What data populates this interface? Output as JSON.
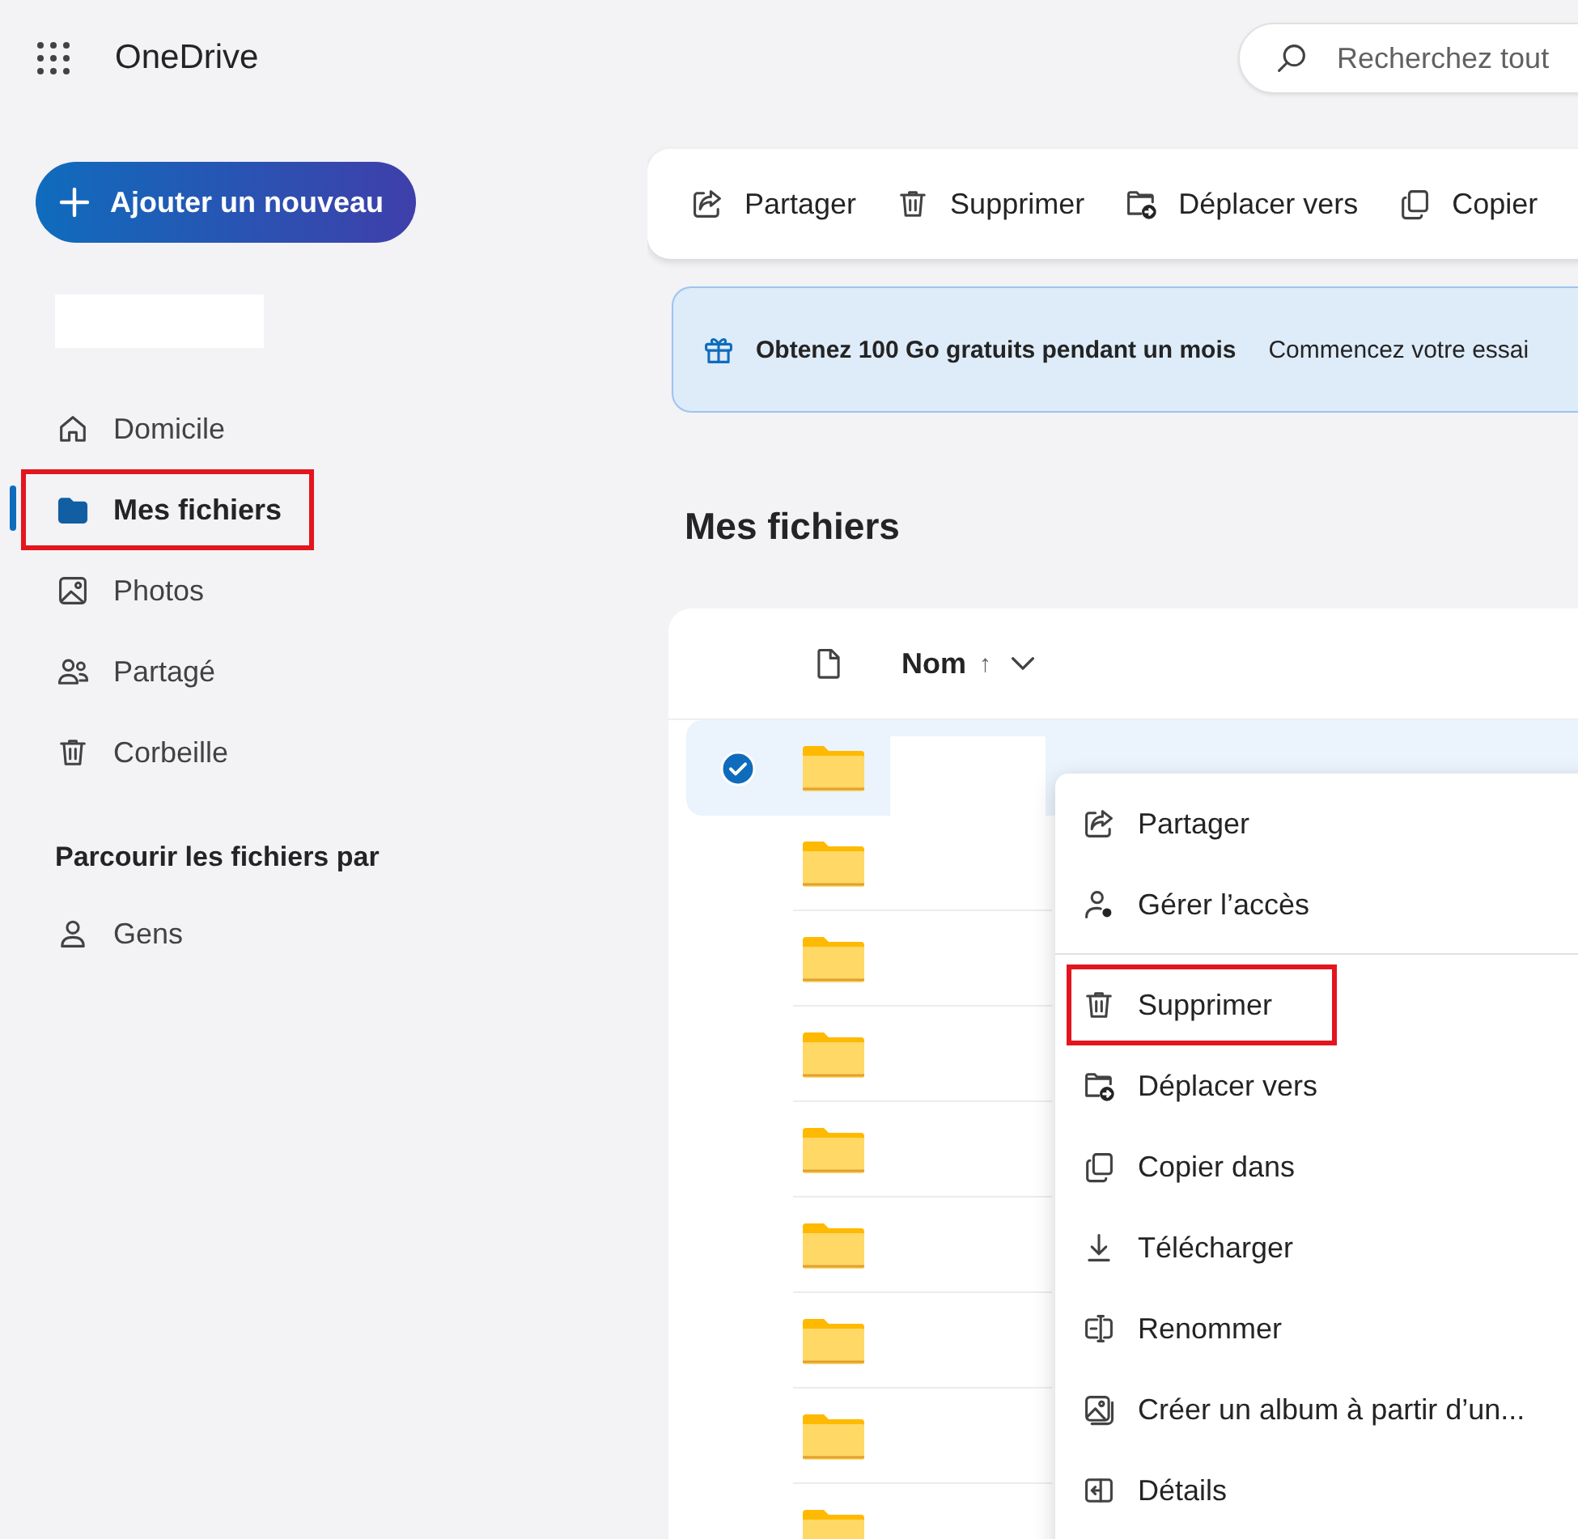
{
  "app": {
    "title": "OneDrive"
  },
  "search": {
    "placeholder": "Recherchez tout"
  },
  "new_button": {
    "label": "Ajouter un nouveau"
  },
  "sidebar": {
    "items": [
      {
        "label": "Domicile",
        "selected": false,
        "highlighted": false
      },
      {
        "label": "Mes fichiers",
        "selected": true,
        "highlighted": true
      },
      {
        "label": "Photos",
        "selected": false,
        "highlighted": false
      },
      {
        "label": "Partagé",
        "selected": false,
        "highlighted": false
      },
      {
        "label": "Corbeille",
        "selected": false,
        "highlighted": false
      }
    ],
    "browse_heading": "Parcourir les fichiers par",
    "browse_items": [
      {
        "label": "Gens",
        "selected": false,
        "highlighted": false
      }
    ]
  },
  "toolbar": [
    "Partager",
    "Supprimer",
    "Déplacer vers",
    "Copier"
  ],
  "banner": {
    "title": "Obtenez 100 Go gratuits pendant un mois",
    "action": "Commencez votre essai"
  },
  "heading": "Mes fichiers",
  "file_list": {
    "column": "Nom",
    "sort": "↑",
    "rows": [
      {
        "selected": true
      },
      {
        "selected": false
      },
      {
        "selected": false
      },
      {
        "selected": false
      },
      {
        "selected": false
      },
      {
        "selected": false
      },
      {
        "selected": false
      },
      {
        "selected": false
      },
      {
        "selected": false
      }
    ]
  },
  "context_menu": {
    "items": [
      {
        "kind": "item",
        "label": "Partager",
        "highlighted": false
      },
      {
        "kind": "item",
        "label": "Gérer l’accès",
        "highlighted": false
      },
      {
        "kind": "separator"
      },
      {
        "kind": "item",
        "label": "Supprimer",
        "highlighted": true
      },
      {
        "kind": "item",
        "label": "Déplacer vers",
        "highlighted": false
      },
      {
        "kind": "item",
        "label": "Copier dans",
        "highlighted": false
      },
      {
        "kind": "item",
        "label": "Télécharger",
        "highlighted": false
      },
      {
        "kind": "item",
        "label": "Renommer",
        "highlighted": false
      },
      {
        "kind": "item",
        "label": "Créer un album à partir d’un...",
        "highlighted": false
      },
      {
        "kind": "item",
        "label": "Détails",
        "highlighted": false
      }
    ]
  }
}
